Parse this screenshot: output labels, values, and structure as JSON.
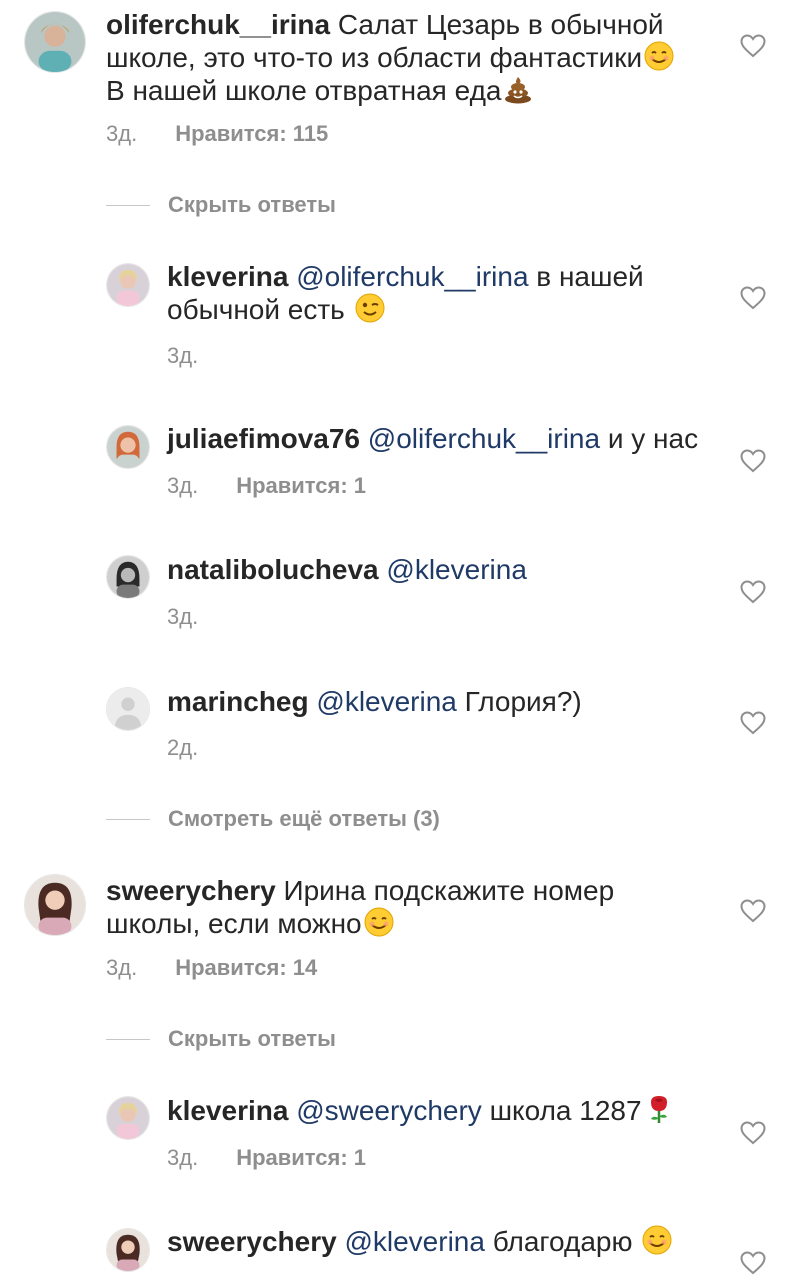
{
  "comments": [
    {
      "user": "oliferchuk__irina",
      "lines": [
        "Салат Цезарь в обычной",
        "школе, это что-то из области фантастики",
        "В нашей школе отвратная еда"
      ],
      "emojis": [
        "smiling-face-emoji",
        "pile-of-poo-emoji"
      ],
      "time": "3д.",
      "likes": "Нравится: 115",
      "replies_toggle": "Скрыть ответы",
      "replies": [
        {
          "user": "kleverina",
          "mention": "@oliferchuk__irina",
          "text_line1": "в нашей",
          "text_line2": "обычной есть",
          "emoji": "winking-face-emoji",
          "time": "3д."
        },
        {
          "user": "juliaefimova76",
          "mention": "@oliferchuk__irina",
          "text": "и у нас",
          "time": "3д.",
          "likes": "Нравится: 1"
        },
        {
          "user": "natalibolucheva",
          "mention": "@kleverina",
          "time": "3д."
        },
        {
          "user": "marincheg",
          "mention": "@kleverina",
          "text": "Глория?)",
          "time": "2д."
        }
      ],
      "more_replies": "Смотреть ещё ответы (3)"
    },
    {
      "user": "sweerychery",
      "line1": "Ирина подскажите номер",
      "line2": "школы, если можно",
      "emoji": "smiling-face-emoji",
      "time": "3д.",
      "likes": "Нравится: 14",
      "replies_toggle": "Скрыть ответы",
      "replies": [
        {
          "user": "kleverina",
          "mention": "@sweerychery",
          "text": "школа 1287",
          "emoji": "rose-emoji",
          "time": "3д.",
          "likes": "Нравится: 1"
        },
        {
          "user": "sweerychery",
          "mention": "@kleverina",
          "text": "благодарю",
          "emoji": "smiling-face-emoji"
        }
      ]
    }
  ],
  "icons": {
    "like": "heart-outline-icon",
    "default_avatar": "default-user-avatar"
  },
  "colors": {
    "mention": "#1f3a66",
    "meta": "#8e8e8e"
  }
}
